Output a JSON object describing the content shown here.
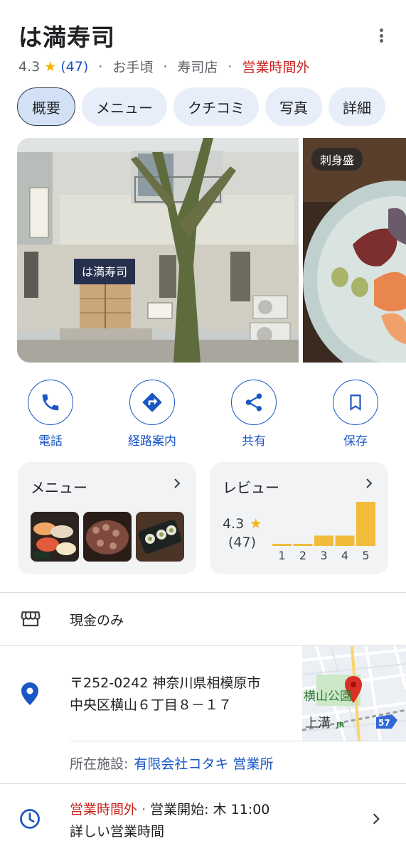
{
  "place": {
    "name": "は満寿司",
    "rating": "4.3",
    "review_count": "(47)",
    "price": "お手頃",
    "category": "寿司店",
    "status": "営業時間外"
  },
  "tabs": [
    {
      "label": "概要",
      "active": true
    },
    {
      "label": "メニュー"
    },
    {
      "label": "クチコミ"
    },
    {
      "label": "写真"
    },
    {
      "label": "詳細"
    }
  ],
  "photos": {
    "main_sign": "は満寿司",
    "side_label": "刺身盛"
  },
  "actions": [
    {
      "label": "電話",
      "icon": "phone-icon"
    },
    {
      "label": "経路案内",
      "icon": "directions-icon"
    },
    {
      "label": "共有",
      "icon": "share-icon"
    },
    {
      "label": "保存",
      "icon": "bookmark-icon"
    }
  ],
  "menu_card": {
    "title": "メニュー"
  },
  "review_card": {
    "title": "レビュー",
    "rating": "4.3",
    "count": "(47)",
    "distribution": [
      {
        "stars": "1",
        "share": 0.03
      },
      {
        "stars": "2",
        "share": 0.03
      },
      {
        "stars": "3",
        "share": 0.15
      },
      {
        "stars": "4",
        "share": 0.15
      },
      {
        "stars": "5",
        "share": 0.64
      }
    ]
  },
  "payment": {
    "text": "現金のみ"
  },
  "address": {
    "line1": "〒252-0242 神奈川県相模原市",
    "line2": "中央区横山６丁目８－１７",
    "facility_label": "所在施設:",
    "facility_value": "有限会社コタキ 営業所"
  },
  "map": {
    "area_label": "横山公園",
    "station_label": "上溝",
    "rail_badge": "JR",
    "route_number": "57"
  },
  "hours": {
    "status": "営業時間外",
    "separator": "·",
    "next_open": "営業開始: 木 11:00",
    "details_link": "詳しい営業時間"
  },
  "colors": {
    "accent": "#1a56c4",
    "closed": "#c5221f",
    "star": "#f4b400",
    "bar": "#f1bc3a"
  }
}
